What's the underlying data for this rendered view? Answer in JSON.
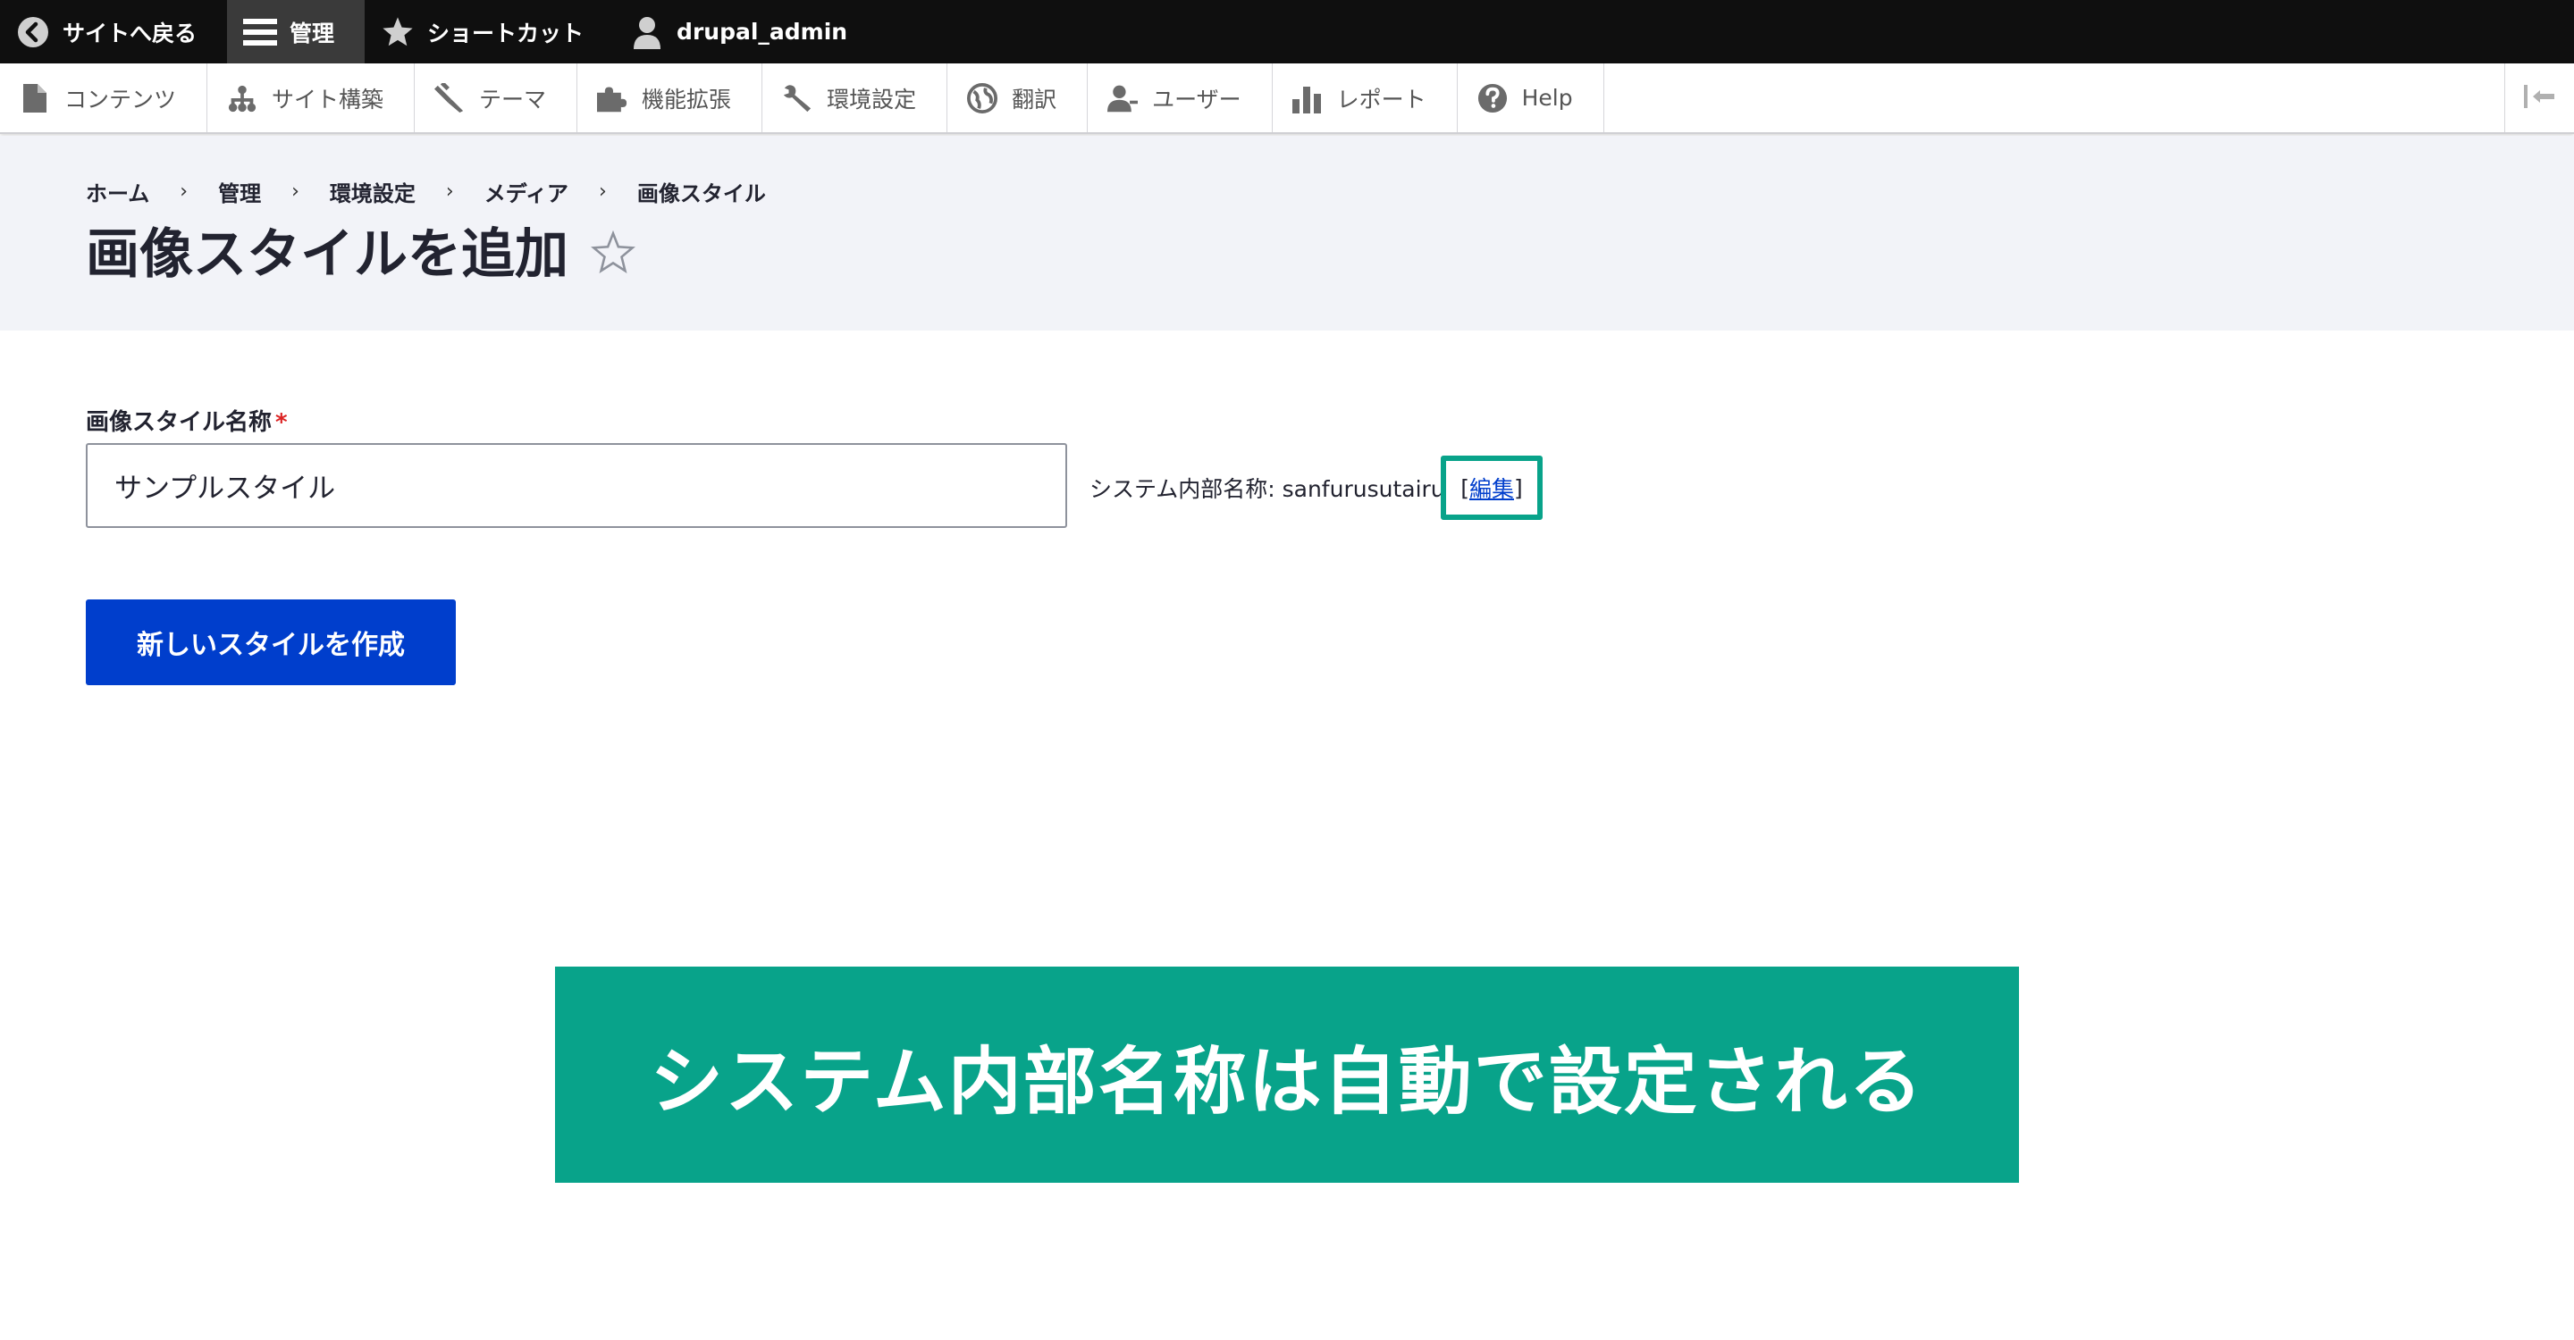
{
  "topbar": {
    "back": "サイトへ戻る",
    "manage": "管理",
    "shortcuts": "ショートカット",
    "user": "drupal_admin"
  },
  "tray": {
    "items": [
      "コンテンツ",
      "サイト構築",
      "テーマ",
      "機能拡張",
      "環境設定",
      "翻訳",
      "ユーザー",
      "レポート",
      "Help"
    ]
  },
  "breadcrumb": [
    "ホーム",
    "管理",
    "環境設定",
    "メディア",
    "画像スタイル"
  ],
  "page": {
    "title": "画像スタイルを追加",
    "star": "☆"
  },
  "form": {
    "label": "画像スタイル名称",
    "required_mark": "*",
    "value": "サンプルスタイル",
    "machine_name_label": "システム内部名称: sanfurusutairu",
    "edit_link": "編集",
    "submit": "新しいスタイルを作成"
  },
  "callout": {
    "text": "システム内部名称は自動で設定される"
  },
  "colors": {
    "accent": "#08a38a",
    "primary_button": "#003ecc",
    "toolbar": "#0f0f0f"
  }
}
